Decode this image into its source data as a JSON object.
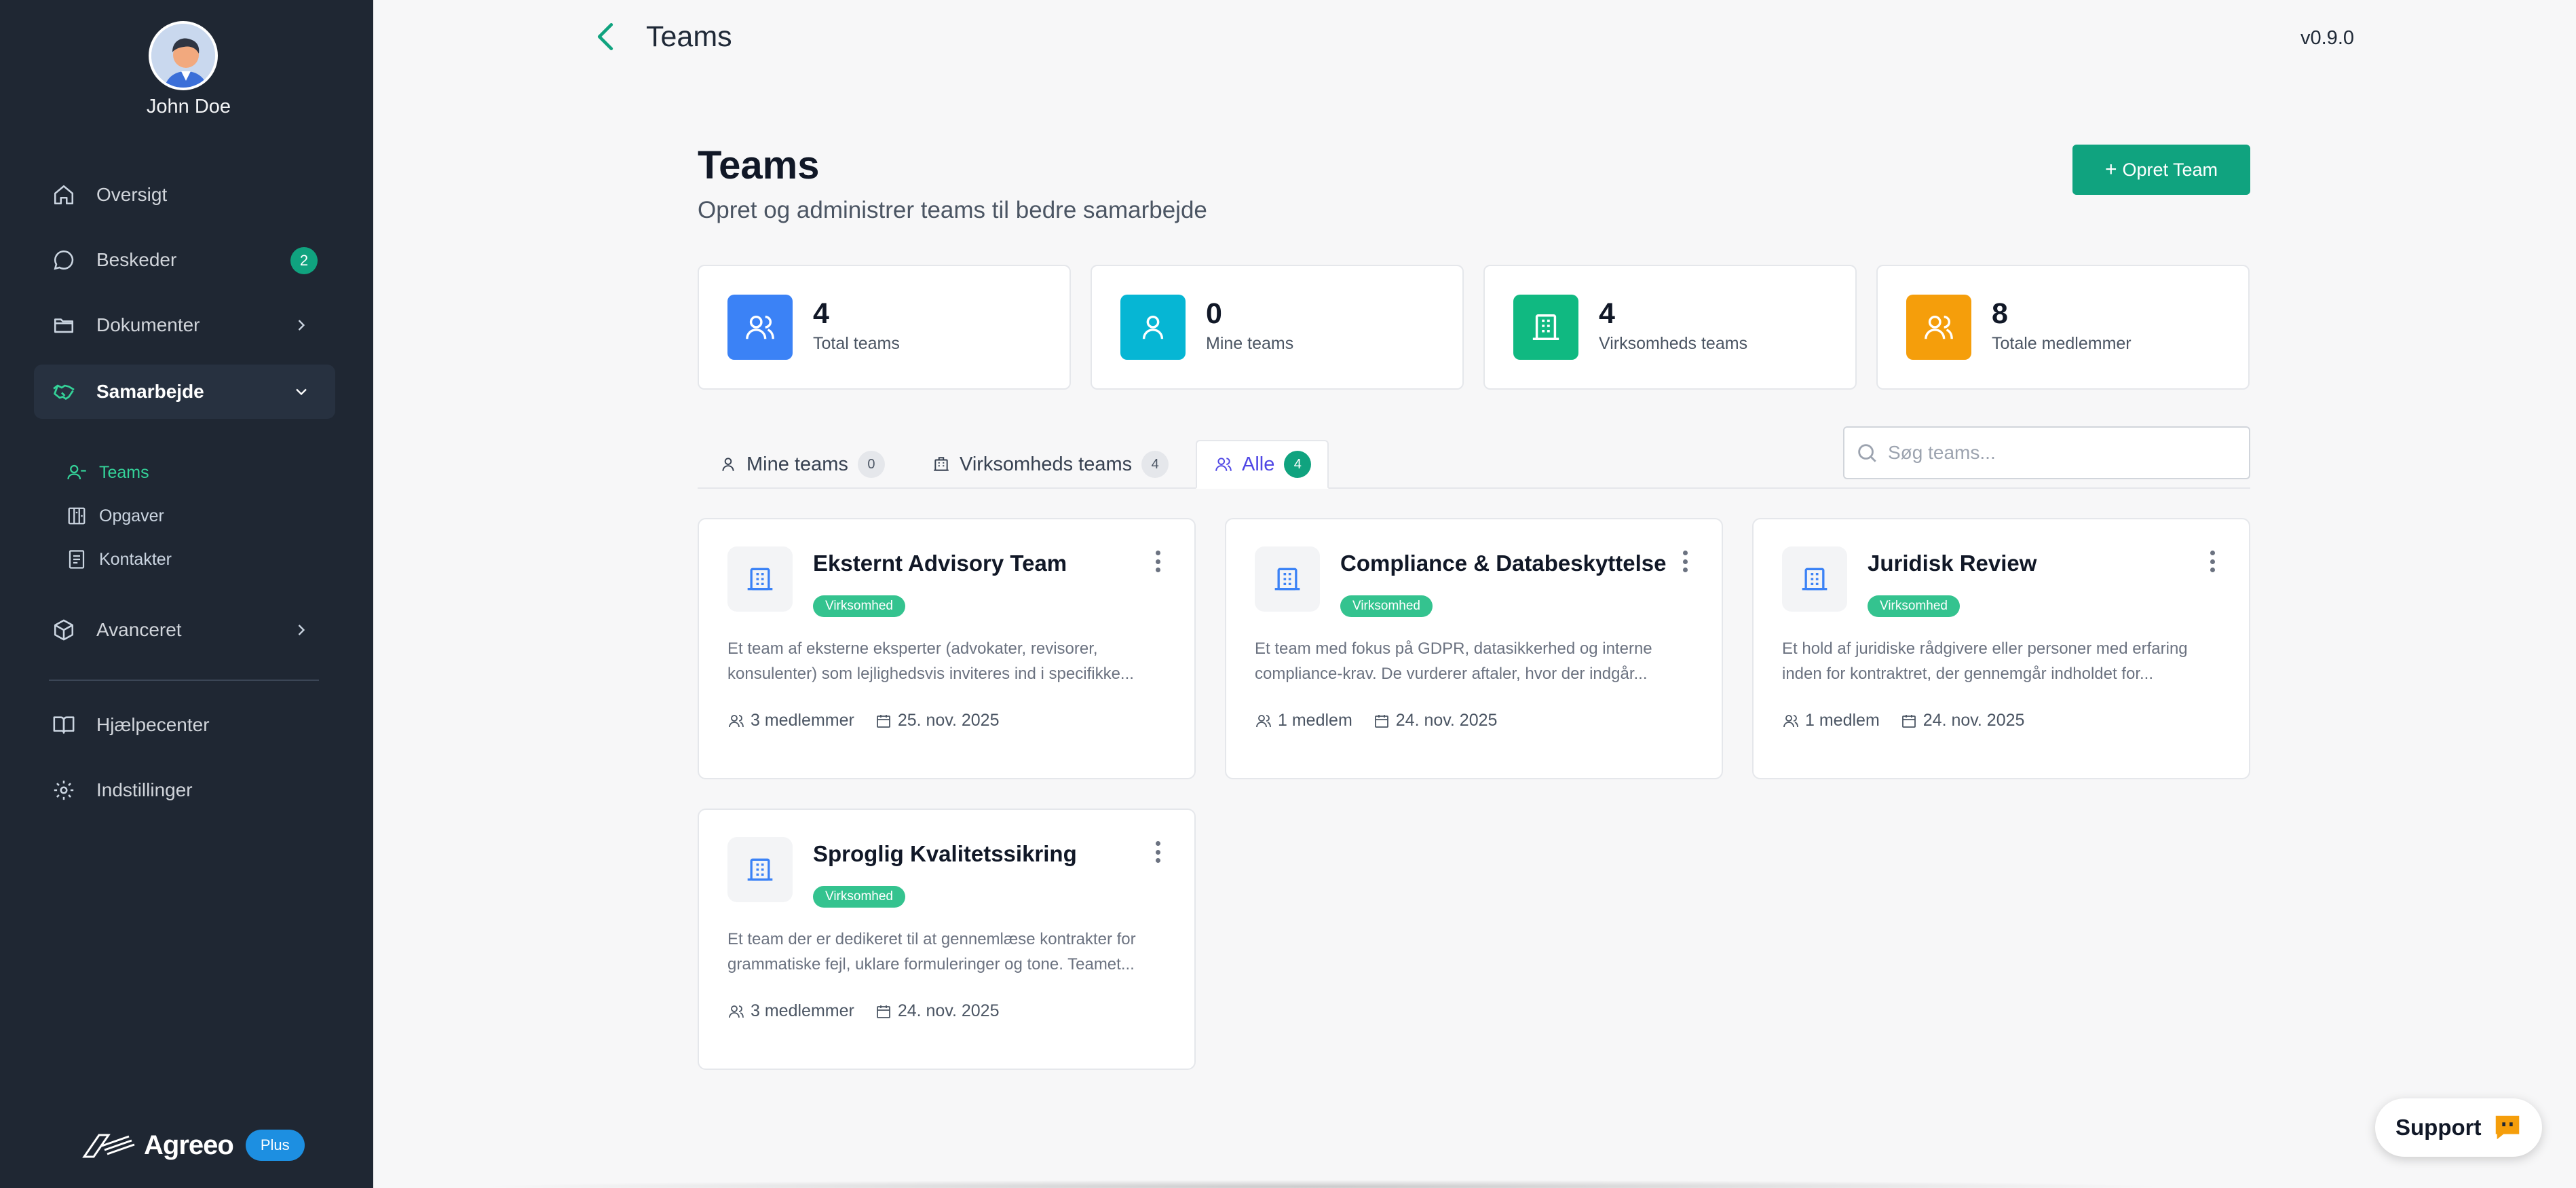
{
  "user": {
    "name": "John Doe"
  },
  "sidebar": {
    "items": [
      {
        "label": "Oversigt",
        "icon": "home-icon"
      },
      {
        "label": "Beskeder",
        "icon": "message-icon",
        "badge": "2"
      },
      {
        "label": "Dokumenter",
        "icon": "folder-icon"
      },
      {
        "label": "Samarbejde",
        "icon": "handshake-icon"
      },
      {
        "label": "Avanceret",
        "icon": "cube-icon"
      },
      {
        "label": "Hjælpecenter",
        "icon": "book-icon"
      },
      {
        "label": "Indstillinger",
        "icon": "gear-icon"
      }
    ],
    "subitems": [
      {
        "label": "Teams",
        "icon": "users-icon"
      },
      {
        "label": "Opgaver",
        "icon": "kanban-icon"
      },
      {
        "label": "Kontakter",
        "icon": "contacts-icon"
      }
    ],
    "logo_text": "Agreeo",
    "plan_badge": "Plus"
  },
  "header": {
    "title": "Teams",
    "version": "v0.9.0"
  },
  "page": {
    "title": "Teams",
    "subtitle": "Opret og administrer teams til bedre samarbejde",
    "create_label": "Opret Team"
  },
  "stats": [
    {
      "value": "4",
      "label": "Total teams",
      "color": "#3b82f6",
      "icon": "users-icon"
    },
    {
      "value": "0",
      "label": "Mine teams",
      "color": "#06b6d4",
      "icon": "user-icon"
    },
    {
      "value": "4",
      "label": "Virksomheds teams",
      "color": "#10b981",
      "icon": "building-icon"
    },
    {
      "value": "8",
      "label": "Totale medlemmer",
      "color": "#f59e0b",
      "icon": "users-icon"
    }
  ],
  "tabs": [
    {
      "label": "Mine teams",
      "count": "0"
    },
    {
      "label": "Virksomheds teams",
      "count": "4"
    },
    {
      "label": "Alle",
      "count": "4"
    }
  ],
  "search": {
    "placeholder": "Søg teams..."
  },
  "teams": [
    {
      "name": "Eksternt Advisory Team",
      "badge": "Virksomhed",
      "desc1": "Et team af eksterne eksperter (advokater, revisorer,",
      "desc2": "konsulenter) som lejlighedsvis inviteres ind i specifikke...",
      "members": "3 medlemmer",
      "date": "25. nov. 2025"
    },
    {
      "name": "Compliance & Databeskyttelse",
      "badge": "Virksomhed",
      "desc1": "Et team med fokus på GDPR, datasikkerhed og interne",
      "desc2": "compliance-krav. De vurderer aftaler, hvor der indgår...",
      "members": "1 medlem",
      "date": "24. nov. 2025"
    },
    {
      "name": "Juridisk Review",
      "badge": "Virksomhed",
      "desc1": "Et hold af juridiske rådgivere eller personer med erfaring",
      "desc2": "inden for kontraktret, der gennemgår indholdet for...",
      "members": "1 medlem",
      "date": "24. nov. 2025"
    },
    {
      "name": "Sproglig Kvalitetssikring",
      "badge": "Virksomhed",
      "desc1": "Et team der er dedikeret til at gennemlæse kontrakter for",
      "desc2": "grammatiske fejl, uklare formuleringer og tone. Teamet...",
      "members": "3 medlemmer",
      "date": "24. nov. 2025"
    }
  ],
  "support": {
    "label": "Support"
  },
  "colors": {
    "accent": "#10a37f",
    "sidebar_bg": "#1f2733",
    "team_icon": "#3b82f6"
  }
}
